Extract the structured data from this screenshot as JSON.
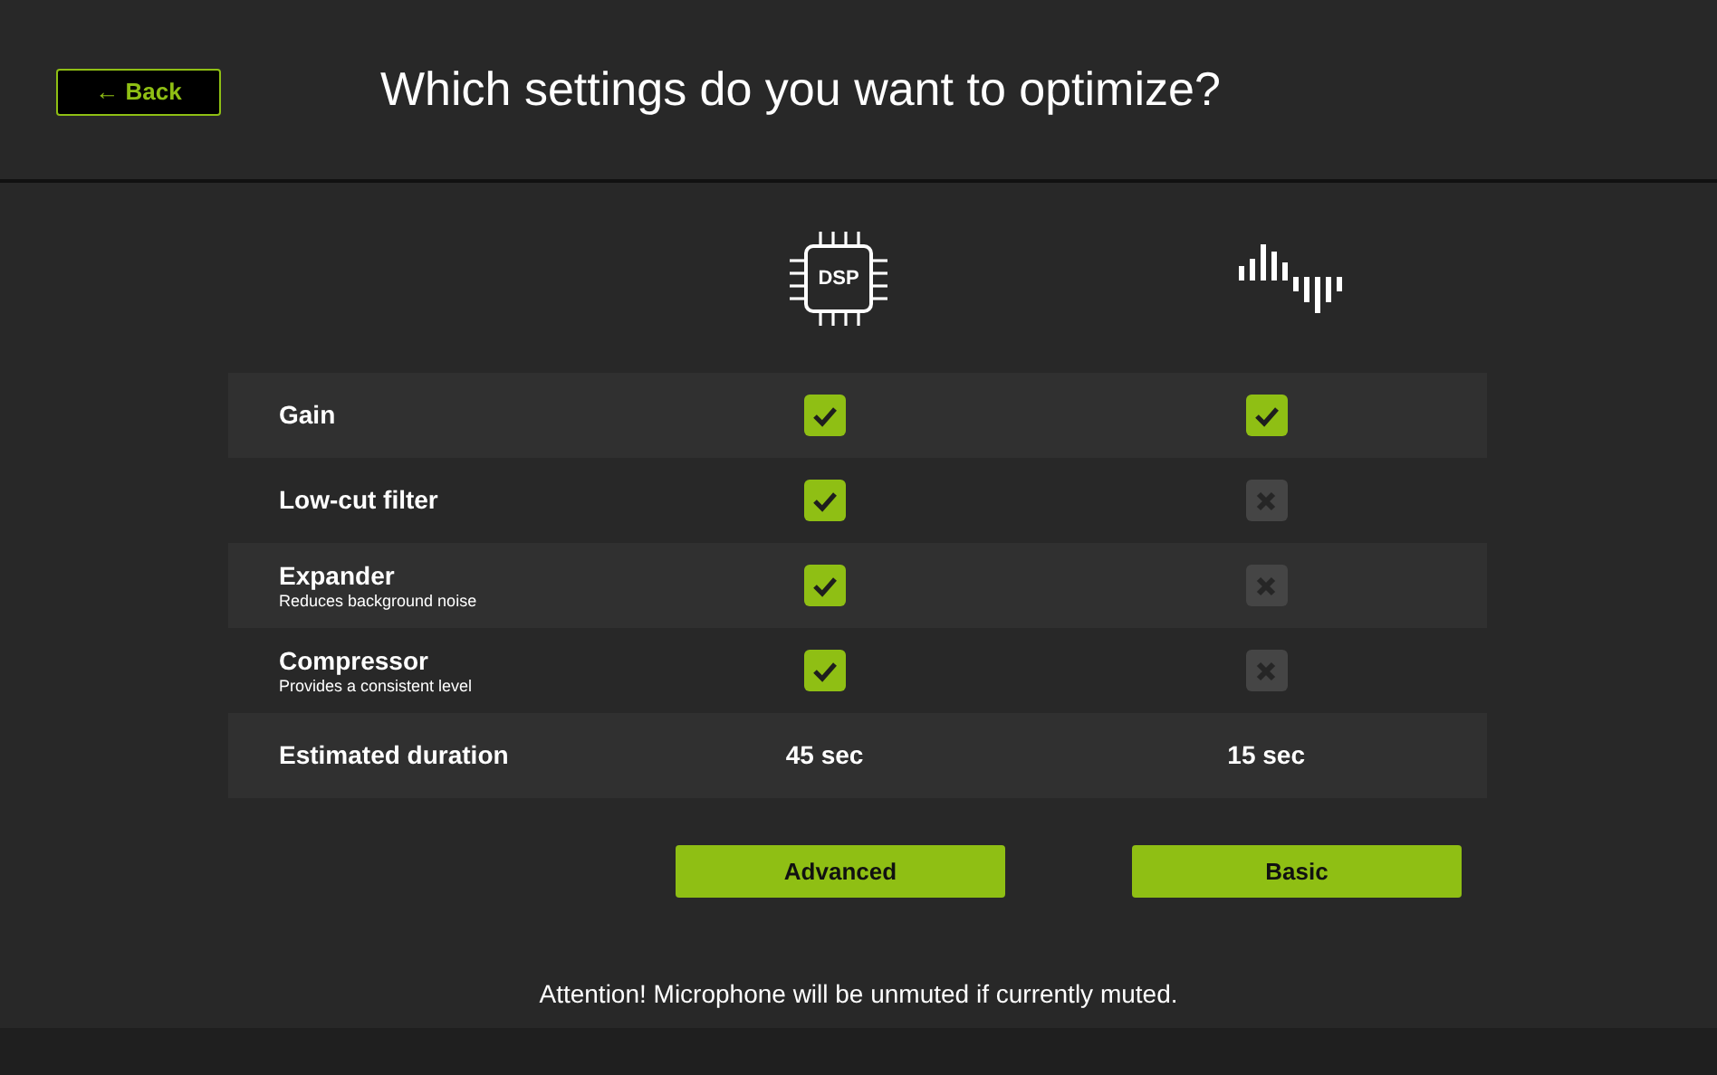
{
  "back_button": "← Back",
  "title": "Which settings do you want to optimize?",
  "columns": [
    {
      "kind": "dsp"
    },
    {
      "kind": "wave"
    }
  ],
  "rows": [
    {
      "kind": "check",
      "label": "Gain",
      "cells": [
        {
          "checked": true
        },
        {
          "checked": true
        }
      ]
    },
    {
      "kind": "check",
      "label": "Low-cut filter",
      "cells": [
        {
          "checked": true
        },
        {
          "checked": false
        }
      ]
    },
    {
      "kind": "check",
      "label": "Expander",
      "description": "Reduces background noise",
      "cells": [
        {
          "checked": true
        },
        {
          "checked": false
        }
      ]
    },
    {
      "kind": "check",
      "label": "Compressor",
      "description": "Provides a consistent level",
      "cells": [
        {
          "checked": true
        },
        {
          "checked": false
        }
      ]
    },
    {
      "kind": "text",
      "label": "Estimated duration",
      "cells": [
        {
          "text": "45 sec"
        },
        {
          "text": "15 sec"
        }
      ]
    }
  ],
  "dsp_label": "DSP",
  "buttons": [
    "Advanced",
    "Basic"
  ],
  "notice": "Attention! Microphone will be unmuted if currently muted."
}
